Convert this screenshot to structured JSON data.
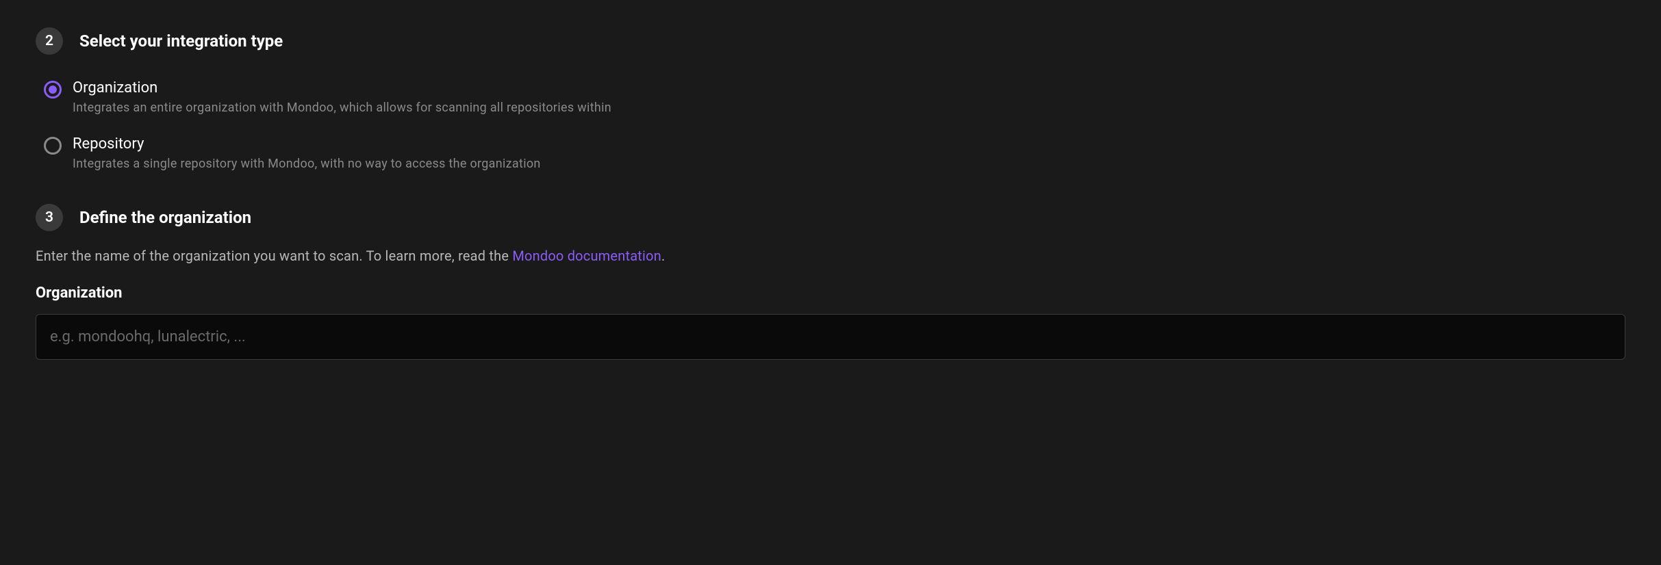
{
  "step2": {
    "number": "2",
    "title": "Select your integration type",
    "options": [
      {
        "label": "Organization",
        "description": "Integrates an entire organization with Mondoo, which allows for scanning all repositories within",
        "selected": true
      },
      {
        "label": "Repository",
        "description": "Integrates a single repository with Mondoo, with no way to access the organization",
        "selected": false
      }
    ]
  },
  "step3": {
    "number": "3",
    "title": "Define the organization",
    "instruction_prefix": "Enter the name of the organization you want to scan. To learn more, read the ",
    "instruction_link": "Mondoo documentation",
    "instruction_suffix": ".",
    "field_label": "Organization",
    "placeholder": "e.g. mondoohq, lunalectric, ..."
  }
}
